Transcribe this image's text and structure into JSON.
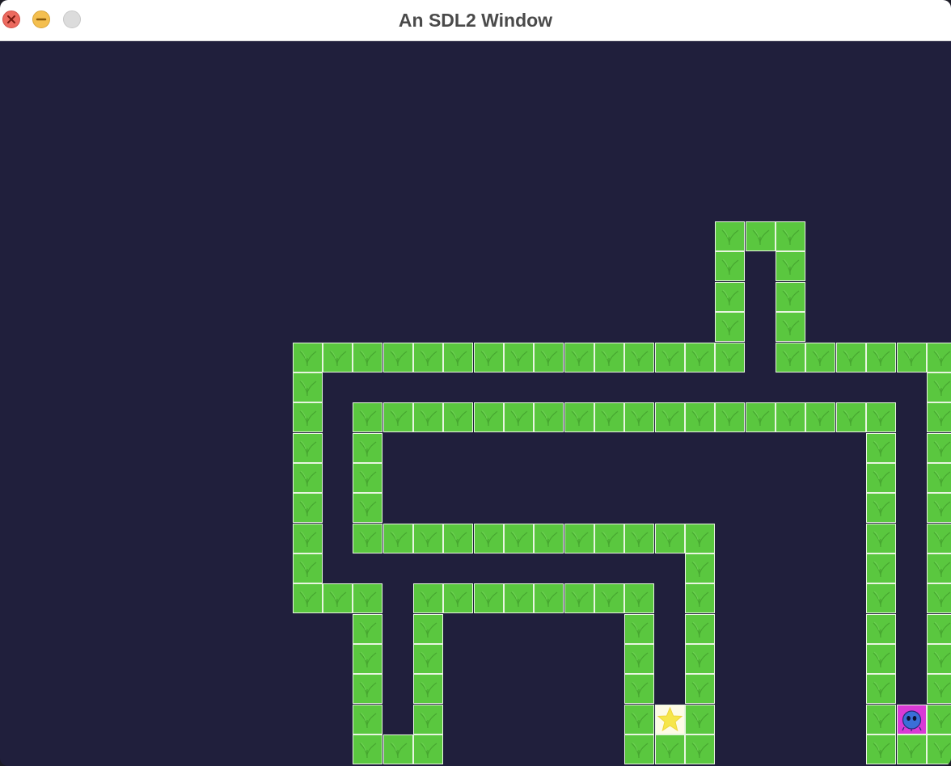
{
  "window": {
    "title": "An SDL2 Window"
  },
  "controls": {
    "close": "close-button",
    "minimize": "minimize-button",
    "zoom": "zoom-button"
  },
  "colors": {
    "background": "#201f3c",
    "grass": "#5ac73f",
    "grass_border": "#e8f5e0",
    "goal_star": "#f6e64a",
    "player_body": "#3a6fd8",
    "player_tile": "#d93ad6"
  },
  "maze": {
    "tile_size_units": 1,
    "grass_cells": [
      [
        24,
        6
      ],
      [
        25,
        6
      ],
      [
        26,
        6
      ],
      [
        24,
        7
      ],
      [
        26,
        7
      ],
      [
        24,
        8
      ],
      [
        26,
        8
      ],
      [
        24,
        9
      ],
      [
        26,
        9
      ],
      [
        10,
        10
      ],
      [
        11,
        10
      ],
      [
        12,
        10
      ],
      [
        13,
        10
      ],
      [
        14,
        10
      ],
      [
        15,
        10
      ],
      [
        16,
        10
      ],
      [
        17,
        10
      ],
      [
        18,
        10
      ],
      [
        19,
        10
      ],
      [
        20,
        10
      ],
      [
        21,
        10
      ],
      [
        22,
        10
      ],
      [
        23,
        10
      ],
      [
        24,
        10
      ],
      [
        26,
        10
      ],
      [
        27,
        10
      ],
      [
        28,
        10
      ],
      [
        29,
        10
      ],
      [
        30,
        10
      ],
      [
        31,
        10
      ],
      [
        10,
        11
      ],
      [
        31,
        11
      ],
      [
        10,
        12
      ],
      [
        12,
        12
      ],
      [
        13,
        12
      ],
      [
        14,
        12
      ],
      [
        15,
        12
      ],
      [
        16,
        12
      ],
      [
        17,
        12
      ],
      [
        18,
        12
      ],
      [
        19,
        12
      ],
      [
        20,
        12
      ],
      [
        21,
        12
      ],
      [
        22,
        12
      ],
      [
        23,
        12
      ],
      [
        24,
        12
      ],
      [
        25,
        12
      ],
      [
        26,
        12
      ],
      [
        27,
        12
      ],
      [
        28,
        12
      ],
      [
        29,
        12
      ],
      [
        31,
        12
      ],
      [
        10,
        13
      ],
      [
        12,
        13
      ],
      [
        29,
        13
      ],
      [
        31,
        13
      ],
      [
        10,
        14
      ],
      [
        12,
        14
      ],
      [
        29,
        14
      ],
      [
        31,
        14
      ],
      [
        10,
        15
      ],
      [
        12,
        15
      ],
      [
        29,
        15
      ],
      [
        31,
        15
      ],
      [
        10,
        16
      ],
      [
        12,
        16
      ],
      [
        13,
        16
      ],
      [
        14,
        16
      ],
      [
        15,
        16
      ],
      [
        16,
        16
      ],
      [
        17,
        16
      ],
      [
        18,
        16
      ],
      [
        19,
        16
      ],
      [
        20,
        16
      ],
      [
        21,
        16
      ],
      [
        22,
        16
      ],
      [
        23,
        16
      ],
      [
        29,
        16
      ],
      [
        31,
        16
      ],
      [
        10,
        17
      ],
      [
        23,
        17
      ],
      [
        29,
        17
      ],
      [
        31,
        17
      ],
      [
        10,
        18
      ],
      [
        11,
        18
      ],
      [
        12,
        18
      ],
      [
        14,
        18
      ],
      [
        15,
        18
      ],
      [
        16,
        18
      ],
      [
        17,
        18
      ],
      [
        18,
        18
      ],
      [
        19,
        18
      ],
      [
        20,
        18
      ],
      [
        21,
        18
      ],
      [
        23,
        18
      ],
      [
        29,
        18
      ],
      [
        31,
        18
      ],
      [
        12,
        19
      ],
      [
        14,
        19
      ],
      [
        21,
        19
      ],
      [
        23,
        19
      ],
      [
        29,
        19
      ],
      [
        31,
        19
      ],
      [
        12,
        20
      ],
      [
        14,
        20
      ],
      [
        21,
        20
      ],
      [
        23,
        20
      ],
      [
        29,
        20
      ],
      [
        31,
        20
      ],
      [
        12,
        21
      ],
      [
        14,
        21
      ],
      [
        21,
        21
      ],
      [
        23,
        21
      ],
      [
        29,
        21
      ],
      [
        31,
        21
      ],
      [
        12,
        22
      ],
      [
        14,
        22
      ],
      [
        21,
        22
      ],
      [
        23,
        22
      ],
      [
        29,
        22
      ],
      [
        31,
        22
      ],
      [
        12,
        23
      ],
      [
        13,
        23
      ],
      [
        14,
        23
      ],
      [
        21,
        23
      ],
      [
        22,
        23
      ],
      [
        23,
        23
      ],
      [
        29,
        23
      ],
      [
        30,
        23
      ],
      [
        31,
        23
      ]
    ],
    "goal": [
      22,
      22
    ],
    "player": [
      30,
      22
    ]
  },
  "sprites": {
    "goal_icon": "star-icon",
    "player_icon": "blob-creature-icon",
    "tile_icon": "grass-leaf-icon"
  }
}
